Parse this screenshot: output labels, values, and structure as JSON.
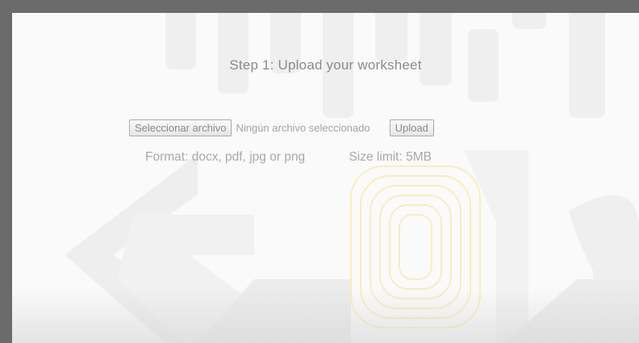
{
  "upload": {
    "title": "Step 1: Upload your worksheet",
    "choose_file_label": "Seleccionar archivo",
    "file_status": "Ningún archivo seleccionado",
    "upload_label": "Upload",
    "format_text": "Format: docx, pdf, jpg or png",
    "size_limit_text": "Size limit: 5MB"
  },
  "colors": {
    "frame": "#6b6b6b",
    "text": "#8a8a8a",
    "watermark": "#ededed",
    "watermark_accent": "#fbf6dc"
  }
}
